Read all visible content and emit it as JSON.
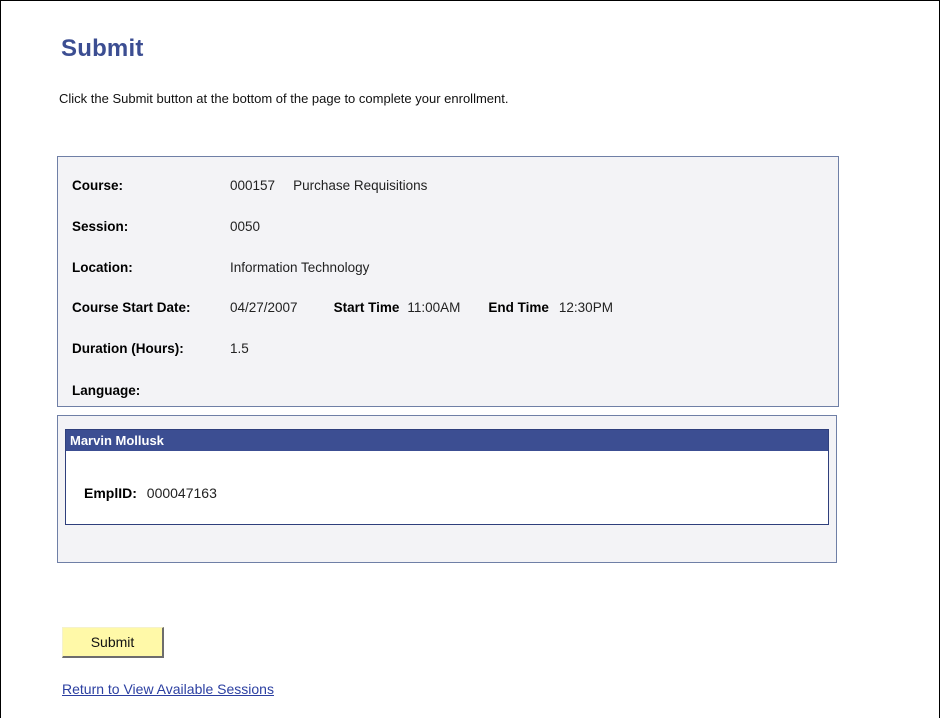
{
  "page": {
    "title": "Submit",
    "instructions": "Click the Submit button at the bottom of the page to complete your enrollment."
  },
  "course": {
    "course_label": "Course:",
    "course_code": "000157",
    "course_name": "Purchase Requisitions",
    "session_label": "Session:",
    "session_value": "0050",
    "location_label": "Location:",
    "location_value": "Information Technology",
    "start_date_label": "Course Start Date:",
    "start_date_value": "04/27/2007",
    "start_time_label": "Start Time",
    "start_time_value": "11:00AM",
    "end_time_label": "End Time",
    "end_time_value": "12:30PM",
    "duration_label": "Duration (Hours):",
    "duration_value": "1.5",
    "language_label": "Language:",
    "language_value": ""
  },
  "employee": {
    "name": "Marvin Mollusk",
    "emplid_label": "EmplID:",
    "emplid_value": "000047163"
  },
  "actions": {
    "submit_label": "Submit",
    "return_link": "Return to View Available Sessions"
  },
  "colors": {
    "title": "#3c4e92",
    "header_bar": "#3c4e92",
    "button_bg": "#fff9a8",
    "link": "#2b3fa1"
  }
}
